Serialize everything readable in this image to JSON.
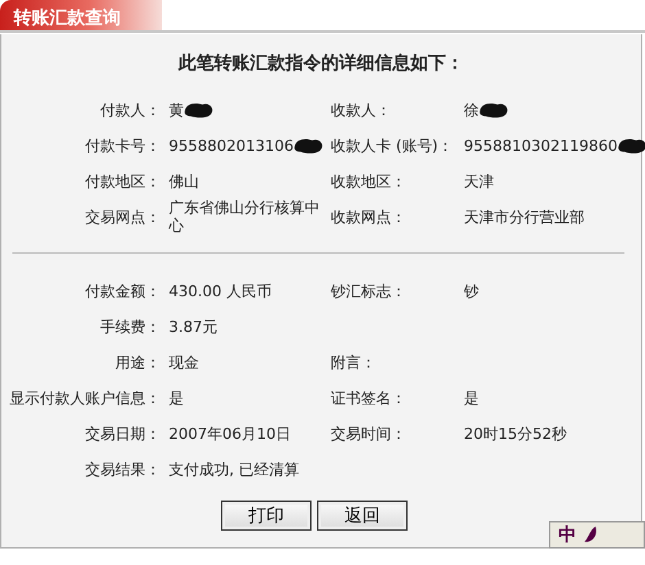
{
  "tab": {
    "label": "转账汇款查询",
    "selected": true
  },
  "heading": "此笔转账汇款指令的详细信息如下：",
  "sections": [
    {
      "rows": [
        [
          {
            "label": "付款人：",
            "value": "黄",
            "redacted": true
          },
          {
            "label": "收款人：",
            "value": "徐",
            "redacted": true
          }
        ],
        [
          {
            "label": "付款卡号：",
            "value": "9558802013106",
            "redacted": true
          },
          {
            "label": "收款人卡 (账号)：",
            "value": "9558810302119860",
            "redacted": true
          }
        ],
        [
          {
            "label": "付款地区：",
            "value": "佛山"
          },
          {
            "label": "收款地区：",
            "value": "天津"
          }
        ],
        [
          {
            "label": "交易网点：",
            "value": "广东省佛山分行核算中心"
          },
          {
            "label": "收款网点：",
            "value": "天津市分行营业部"
          }
        ]
      ]
    },
    {
      "rows": [
        [
          {
            "label": "付款金额：",
            "value": "430.00 人民币"
          },
          {
            "label": "钞汇标志：",
            "value": "钞"
          }
        ],
        [
          {
            "label": "手续费：",
            "value": "3.87元"
          }
        ],
        [
          {
            "label": "用途：",
            "value": "现金"
          },
          {
            "label": "附言："
          }
        ],
        [
          {
            "label": "显示付款人账户信息：",
            "value": "是"
          },
          {
            "label": "证书签名：",
            "value": "是"
          }
        ],
        [
          {
            "label": "交易日期：",
            "value": "2007年06月10日"
          },
          {
            "label": "交易时间：",
            "value": "20时15分52秒"
          }
        ],
        [
          {
            "label": "交易结果：",
            "value": "支付成功, 已经清算"
          }
        ]
      ]
    }
  ],
  "buttons": [
    "打印",
    "返回"
  ],
  "ime_bar": {
    "label": "中"
  }
}
